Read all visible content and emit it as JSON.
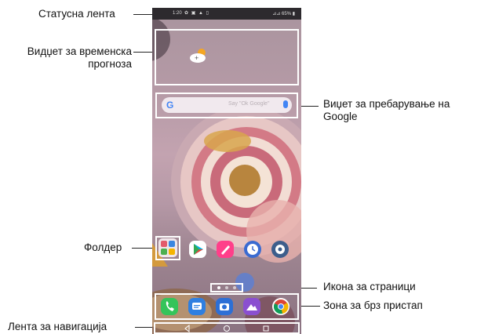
{
  "labels": {
    "status_bar": "Статусна лента",
    "weather_widget_line1": "Видџет за временска",
    "weather_widget_line2": "прогноза",
    "google_search_line1": "Виџет за пребарување на",
    "google_search_line2": "Google",
    "folder": "Фолдер",
    "page_icon": "Икона за страници",
    "quick_access": "Зона за брз пристап",
    "navigation_bar": "Лента за навигација"
  },
  "status_bar": {
    "time": "1:20",
    "status_icons": "✿ ▣ ▲ ▯",
    "battery": "⊿⊿ 65% ▮"
  },
  "search_widget": {
    "logo": "G",
    "placeholder": "Say \"Ok Google\""
  },
  "home_apps": [
    "folder",
    "play-store",
    "pen-app",
    "clock-app",
    "settings-app"
  ],
  "dock_apps": [
    "phone",
    "messages",
    "camera",
    "gallery",
    "chrome"
  ],
  "colors": {
    "play": "#ffffff",
    "pen": "#ff3f8a",
    "clock": "#3a6bd1",
    "settings": "#3d5e8c",
    "phone": "#35c45a",
    "messages": "#2f7fe0",
    "camera": "#2d6fd6",
    "gallery": "#8a4fd0"
  }
}
